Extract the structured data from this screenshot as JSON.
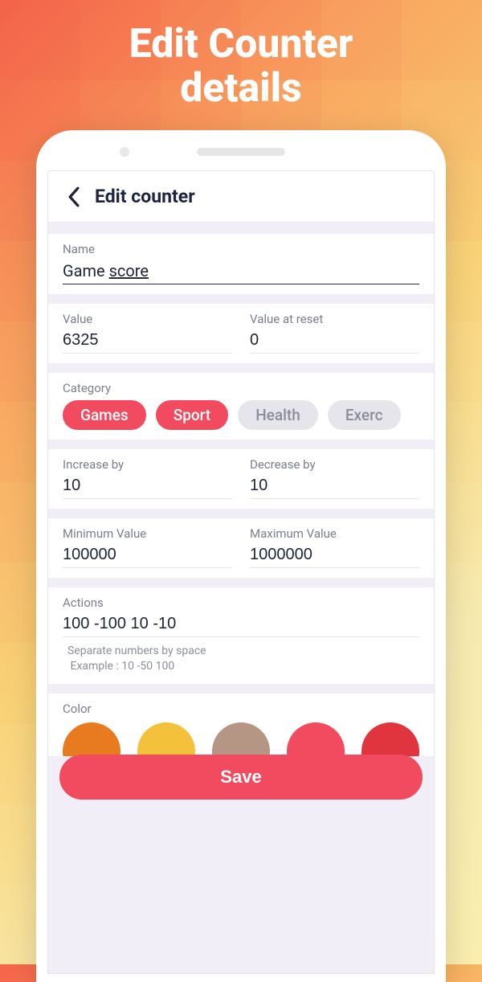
{
  "hero": {
    "line1": "Edit Counter",
    "line2": "details"
  },
  "appbar": {
    "title": "Edit counter"
  },
  "fields": {
    "name_label": "Name",
    "name_value_pre": "Game ",
    "name_value_underlined": "score",
    "value_label": "Value",
    "value_value": "6325",
    "resetvalue_label": "Value at reset",
    "resetvalue_value": "0",
    "category_label": "Category",
    "increase_label": "Increase by",
    "increase_value": "10",
    "decrease_label": "Decrease by",
    "decrease_value": "10",
    "min_label": "Minimum Value",
    "min_value": "100000",
    "max_label": "Maximum Value",
    "max_value": "1000000",
    "actions_label": "Actions",
    "actions_value": "100 -100 10 -10",
    "actions_help_line1": "Separate numbers by space",
    "actions_help_line2": "Example : 10 -50 100",
    "color_label": "Color"
  },
  "categories": [
    {
      "label": "Games",
      "active": true
    },
    {
      "label": "Sport",
      "active": true
    },
    {
      "label": "Health",
      "active": false
    },
    {
      "label": "Exerc",
      "active": false
    }
  ],
  "colors": [
    "#e87b1f",
    "#f3c23a",
    "#b59684",
    "#f24a5e",
    "#e0343e"
  ],
  "save_label": "Save"
}
